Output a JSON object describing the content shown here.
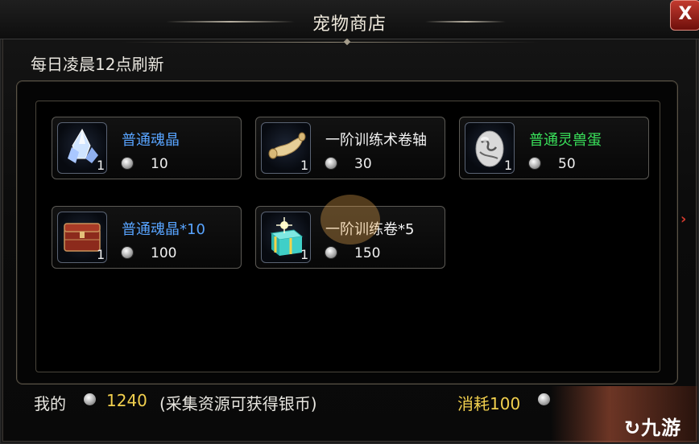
{
  "window": {
    "title": "宠物商店",
    "close_label": "X"
  },
  "refresh_text": "每日凌晨12点刷新",
  "items": [
    {
      "name": "普通魂晶",
      "name_color": "blue",
      "qty": "1",
      "price": "10",
      "icon": "crystal-icon"
    },
    {
      "name": "一阶训练术卷轴",
      "name_color": "white",
      "qty": "1",
      "price": "30",
      "icon": "scroll-icon"
    },
    {
      "name": "普通灵兽蛋",
      "name_color": "green",
      "qty": "1",
      "price": "50",
      "icon": "egg-icon"
    },
    {
      "name": "普通魂晶*10",
      "name_color": "blue",
      "qty": "1",
      "price": "100",
      "icon": "treasure-chest-icon"
    },
    {
      "name": "一阶训练卷*5",
      "name_color": "white",
      "qty": "1",
      "price": "150",
      "icon": "gift-box-icon"
    }
  ],
  "footer": {
    "mine_label": "我的",
    "amount": "1240",
    "note": "(采集资源可获得银币)",
    "cost_label": "消耗100"
  },
  "watermark": "九游",
  "colors": {
    "blue": "#58a4ff",
    "green": "#39e05a",
    "gold": "#f2d04e",
    "close_red": "#c23a2f"
  }
}
